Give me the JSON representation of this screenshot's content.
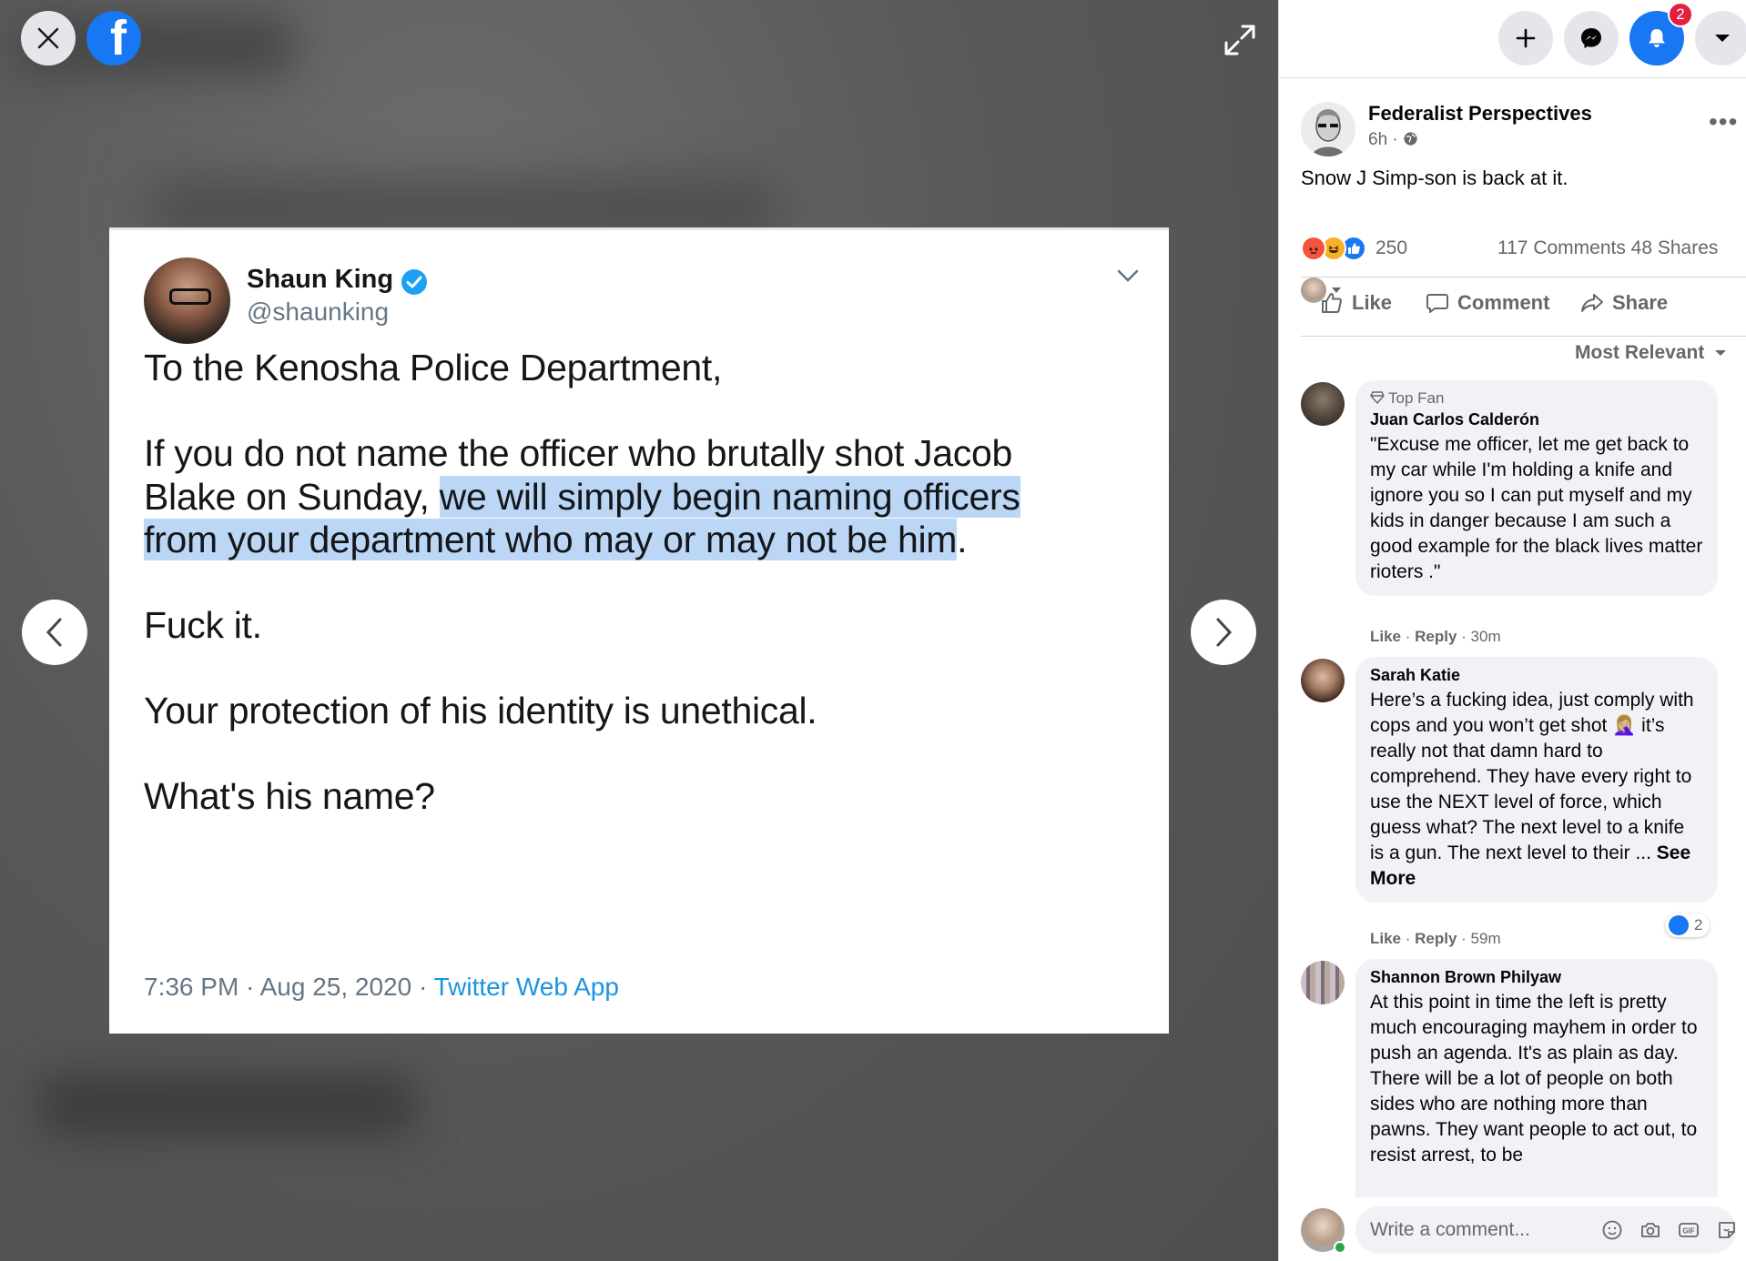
{
  "viewer": {
    "logo_letter": "f",
    "tweet": {
      "name": "Shaun King",
      "handle": "@shaunking",
      "line1": "To the Kenosha Police Department,",
      "line2": "If you do not name the officer who brutally shot Jacob",
      "line3_plain": "Blake on Sunday, ",
      "line3_highlight": "we will simply begin naming officers",
      "line4_highlight": "from your department who may or may not be him",
      "line4_end": ".",
      "line5": "Fuck it.",
      "line6": "Your protection of his identity is unethical.",
      "line7": "What's his name?",
      "meta_time": "7:36 PM · Aug 25, 2020 · ",
      "meta_app": "Twitter Web App"
    }
  },
  "topbar": {
    "notification_count": "2"
  },
  "post": {
    "author": "Federalist Perspectives",
    "time": "6h · ",
    "text": "Snow J Simp-son is back at it.",
    "reaction_count": "250",
    "comments_shares": "117 Comments  48 Shares",
    "actions": {
      "like": "Like",
      "comment": "Comment",
      "share": "Share"
    },
    "sort_label": "Most Relevant"
  },
  "comments": [
    {
      "badge": "Top Fan",
      "author": "Juan Carlos Calderón",
      "text": "\"Excuse me officer, let me get back to my car while I'm holding a knife and ignore you so I can put myself and my kids in danger because I am such a good example for the black lives matter rioters .\"",
      "like": "Like",
      "reply": "Reply",
      "time": "30m"
    },
    {
      "author": "Sarah Katie",
      "text_a": "Here’s a fucking idea, just comply with cops and you won’t get shot ",
      "emoji": "🤦🏼‍♀️",
      "text_b": " it’s really not that damn hard to comprehend. They have every right to use the NEXT level of force, which guess what? The next level to a knife is a gun. The next level to their ... ",
      "see_more": "See More",
      "like": "Like",
      "reply": "Reply",
      "time": "59m",
      "reaction_count": "2"
    },
    {
      "author": "Shannon Brown Philyaw",
      "text": "At this point in time the left is pretty much encouraging mayhem in order to push an agenda. It's as plain as day. There will be a lot of people on both sides who are nothing more than pawns. They want people to act out, to resist arrest, to be"
    }
  ],
  "write_comment": {
    "placeholder": "Write a comment..."
  },
  "colors": {
    "accent": "#1877f2",
    "badge": "#e41e3f",
    "highlight": "#bcd6f5",
    "twitter_link": "#1b95e0"
  },
  "icons": [
    "close-icon",
    "facebook-logo",
    "expand-icon",
    "chevron-left-icon",
    "chevron-right-icon",
    "plus-icon",
    "messenger-icon",
    "bell-icon",
    "caret-down-icon",
    "globe-icon",
    "more-icon",
    "thumbs-up-icon",
    "comment-icon",
    "share-icon",
    "smiley-icon",
    "camera-icon",
    "gif-icon",
    "sticker-icon"
  ]
}
